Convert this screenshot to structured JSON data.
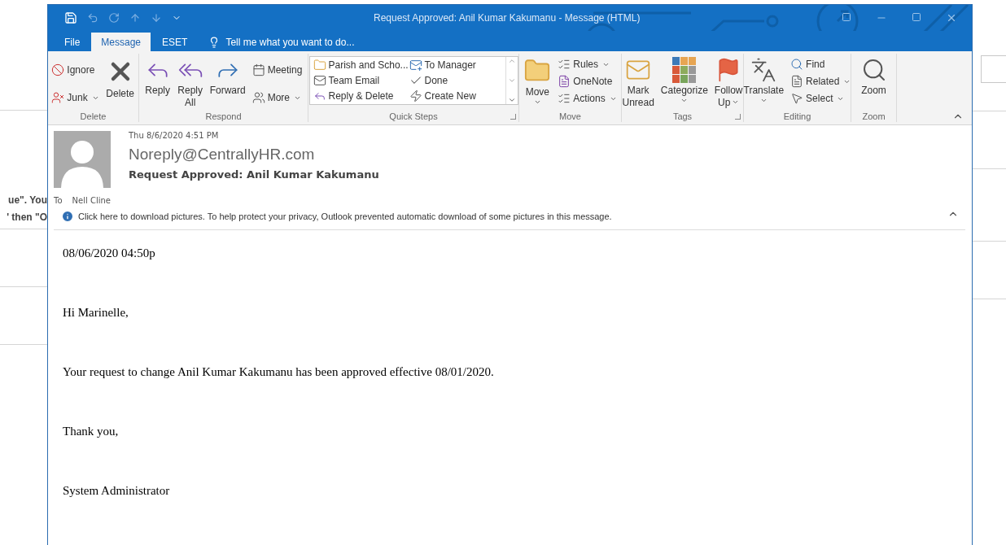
{
  "background": {
    "fragments": [
      "ue\".  You",
      "' then \"O"
    ]
  },
  "window": {
    "title": "Request Approved: Anil Kumar Kakumanu - Message (HTML)"
  },
  "tabs": [
    {
      "label": "File",
      "selected": false
    },
    {
      "label": "Message",
      "selected": true
    },
    {
      "label": "ESET",
      "selected": false
    }
  ],
  "tell_me": {
    "placeholder": "Tell me what you want to do..."
  },
  "ribbon": {
    "groups": [
      {
        "label": "Delete",
        "launcher": false,
        "columns": [
          {
            "kind": "stack",
            "items": [
              {
                "label": "Ignore",
                "dropdown": false
              },
              {
                "label": "Junk",
                "dropdown": true
              }
            ]
          },
          {
            "kind": "large",
            "label": "Delete",
            "dropdown": false
          }
        ]
      },
      {
        "label": "Respond",
        "launcher": false,
        "columns": [
          {
            "kind": "large",
            "label": "Reply",
            "dropdown": false
          },
          {
            "kind": "large",
            "label": "Reply All",
            "dropdown": false
          },
          {
            "kind": "large",
            "label": "Forward",
            "dropdown": false
          },
          {
            "kind": "stack",
            "items": [
              {
                "label": "Meeting",
                "dropdown": false
              },
              {
                "label": "More",
                "dropdown": true
              }
            ]
          }
        ]
      },
      {
        "label": "Quick Steps",
        "launcher": true,
        "columns": [
          {
            "kind": "gallery",
            "items": [
              {
                "label": "Parish and Scho..."
              },
              {
                "label": "To Manager"
              },
              {
                "label": "Team Email"
              },
              {
                "label": "Done"
              },
              {
                "label": "Reply & Delete"
              },
              {
                "label": "Create New"
              }
            ]
          }
        ]
      },
      {
        "label": "Move",
        "launcher": false,
        "columns": [
          {
            "kind": "large",
            "label": "Move",
            "dropdown": true
          },
          {
            "kind": "stack",
            "items": [
              {
                "label": "Rules",
                "dropdown": true
              },
              {
                "label": "OneNote",
                "dropdown": false
              },
              {
                "label": "Actions",
                "dropdown": true
              }
            ]
          }
        ]
      },
      {
        "label": "Tags",
        "launcher": true,
        "columns": [
          {
            "kind": "large",
            "label": "Mark Unread",
            "dropdown": false
          },
          {
            "kind": "large",
            "label": "Categorize",
            "dropdown": true
          },
          {
            "kind": "large",
            "label": "Follow Up",
            "dropdown": true
          }
        ]
      },
      {
        "label": "Editing",
        "launcher": false,
        "columns": [
          {
            "kind": "large",
            "label": "Translate",
            "dropdown": true
          },
          {
            "kind": "stack",
            "items": [
              {
                "label": "Find",
                "dropdown": false
              },
              {
                "label": "Related",
                "dropdown": true
              },
              {
                "label": "Select",
                "dropdown": true
              }
            ]
          }
        ]
      },
      {
        "label": "Zoom",
        "launcher": false,
        "columns": [
          {
            "kind": "large",
            "label": "Zoom",
            "dropdown": false
          }
        ]
      }
    ]
  },
  "message": {
    "date": "Thu 8/6/2020 4:51 PM",
    "sender": "Noreply@CentrallyHR.com",
    "subject": "Request Approved: Anil Kumar Kakumanu",
    "to_label": "To",
    "recipient": "Nell Cline",
    "info_bar": "Click here to download pictures. To help protect your privacy, Outlook prevented automatic download of some pictures in this message."
  },
  "body": {
    "paragraphs": [
      "08/06/2020 04:50p",
      "Hi Marinelle,",
      "Your request to change Anil Kumar Kakumanu has been approved effective 08/01/2020.",
      "Thank you,",
      "System Administrator"
    ]
  }
}
